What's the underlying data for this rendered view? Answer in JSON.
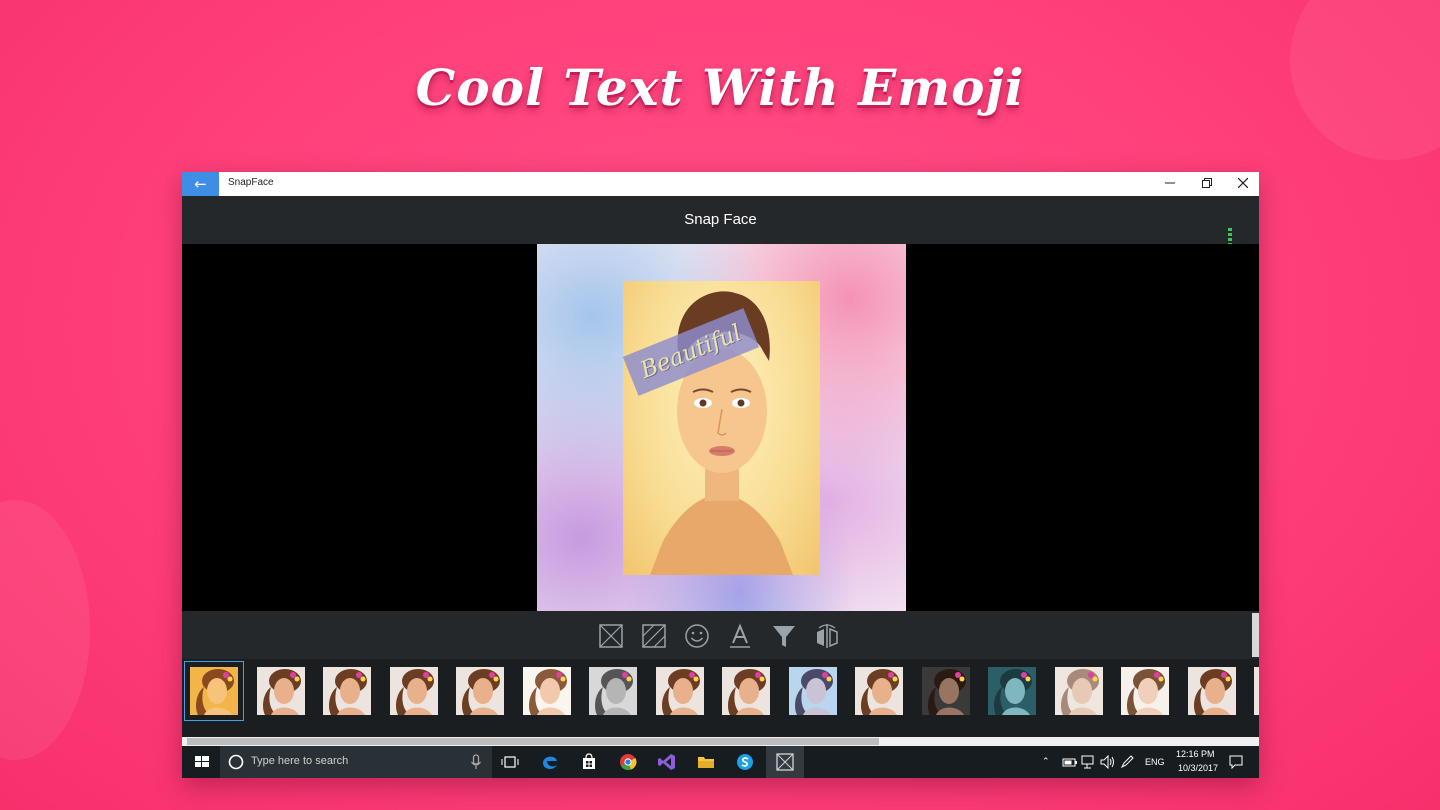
{
  "promo": {
    "headline": "Cool Text With Emoji"
  },
  "window": {
    "app_name": "SnapFace",
    "back_icon": "arrow-left-icon",
    "controls": [
      "minimize-icon",
      "restore-icon",
      "close-icon"
    ]
  },
  "appbar": {
    "title": "Snap Face",
    "save_icon": "download-arrow-icon",
    "accent": "#3fc35c"
  },
  "editor": {
    "sticker_text": "Beautiful"
  },
  "toolbar": {
    "tools": [
      "frame-icon",
      "pattern-icon",
      "emoji-icon",
      "text-icon",
      "filter-icon",
      "flip-icon"
    ]
  },
  "thumbnails": {
    "filters": [
      "warm",
      "normal",
      "normal",
      "normal",
      "normal",
      "bright",
      "mono",
      "normal",
      "normal",
      "cool",
      "normal",
      "dark",
      "teal",
      "sketch",
      "light",
      "normal",
      "normal"
    ],
    "selected_index": 0
  },
  "taskbar": {
    "search_placeholder": "Type here to search",
    "language": "ENG",
    "time": "12:16 PM",
    "date": "10/3/2017"
  },
  "colors": {
    "brand_pink": "#ff3f7a",
    "window_accent": "#3f8ee6",
    "panel": "#25282b"
  }
}
